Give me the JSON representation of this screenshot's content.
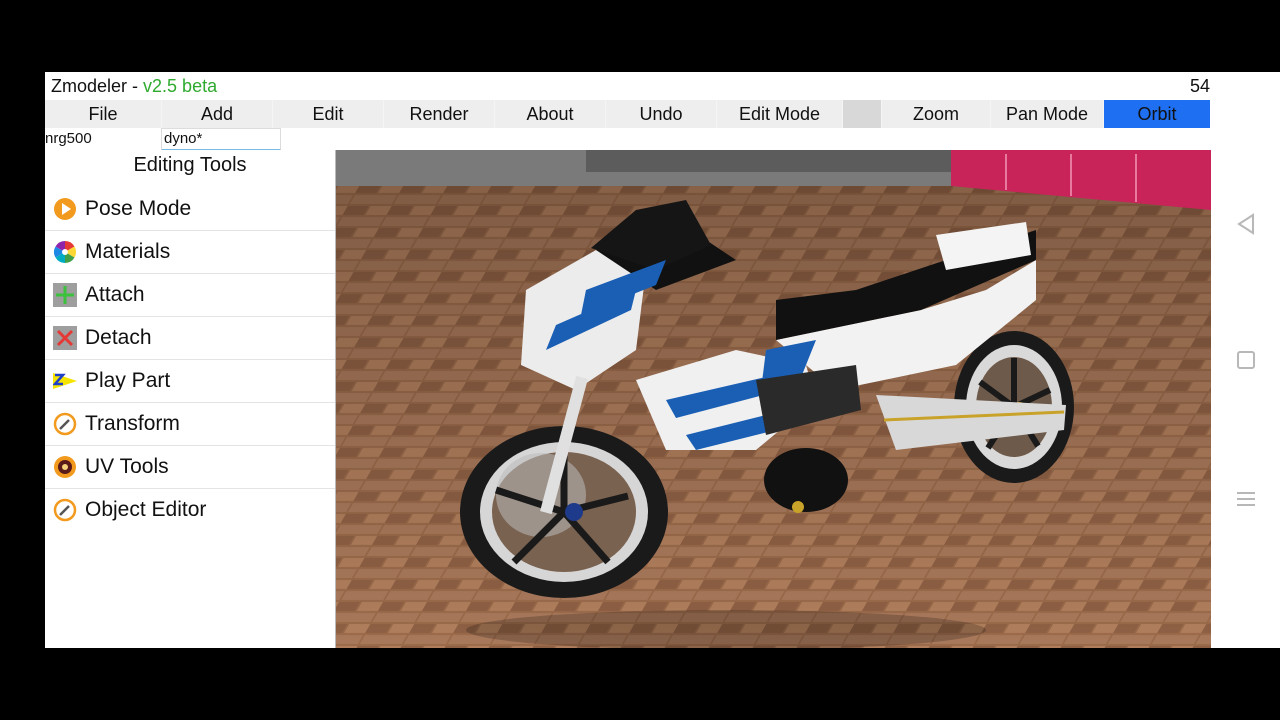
{
  "title": {
    "app": "Zmodeler - ",
    "version": "v2.5 beta",
    "fps": "54"
  },
  "menu": [
    {
      "label": "File"
    },
    {
      "label": "Add"
    },
    {
      "label": "Edit"
    },
    {
      "label": "Render"
    },
    {
      "label": "About"
    },
    {
      "label": "Undo"
    },
    {
      "label": "Edit Mode"
    },
    {
      "label": ""
    },
    {
      "label": "Zoom"
    },
    {
      "label": "Pan Mode"
    },
    {
      "label": "Orbit",
      "active": true
    }
  ],
  "names": {
    "model": "nrg500",
    "part": "dyno*"
  },
  "tools": {
    "title": "Editing Tools",
    "items": [
      {
        "label": "Pose Mode",
        "icon": "play-circle-icon"
      },
      {
        "label": "Materials",
        "icon": "color-wheel-icon"
      },
      {
        "label": "Attach",
        "icon": "plus-icon"
      },
      {
        "label": "Detach",
        "icon": "x-icon"
      },
      {
        "label": "Play Part",
        "icon": "z-arrow-icon"
      },
      {
        "label": "Transform",
        "icon": "pencil-circle-icon"
      },
      {
        "label": "UV Tools",
        "icon": "uv-icon"
      },
      {
        "label": "Object Editor",
        "icon": "pencil-circle-icon"
      }
    ]
  },
  "navigation": {
    "back": "back-triangle-icon",
    "home": "home-square-icon",
    "menu": "menu-lines-icon"
  },
  "colors": {
    "accent": "#1f6ff2",
    "version": "#2eaa2e"
  }
}
